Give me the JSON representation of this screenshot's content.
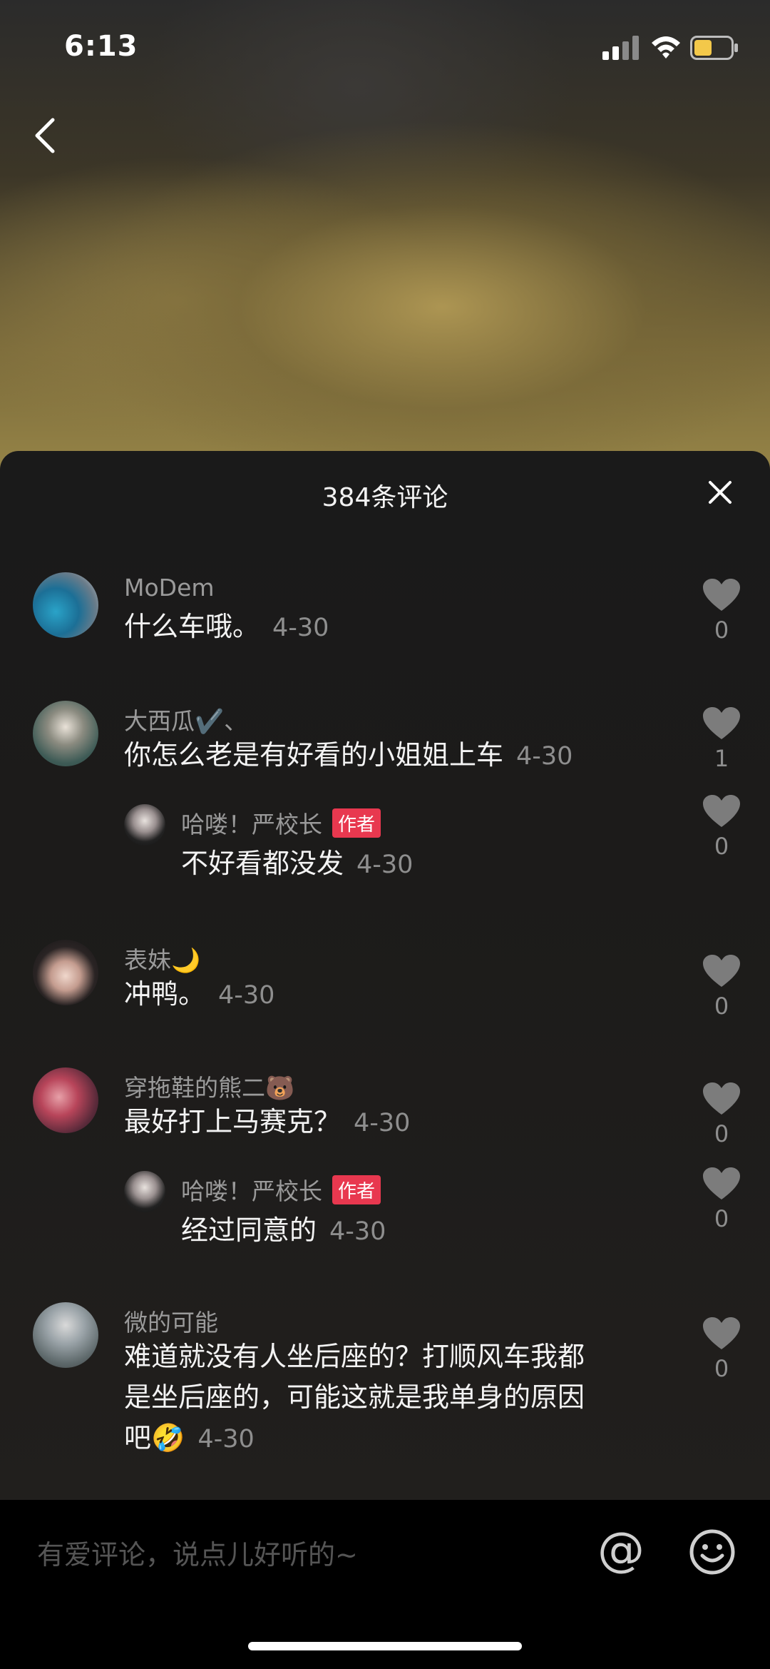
{
  "status_bar": {
    "time": "6:13"
  },
  "sheet": {
    "title": "384条评论"
  },
  "comments": [
    {
      "user": "MoDem",
      "text": "什么车哦。",
      "date": "4-30",
      "likes": "0"
    },
    {
      "user": "大西瓜✔️、",
      "text": "你怎么老是有好看的小姐姐上车",
      "date": "4-30",
      "likes": "1"
    },
    {
      "user": "哈喽！严校长",
      "badge": "作者",
      "text": "不好看都没发",
      "date": "4-30",
      "likes": "0"
    },
    {
      "user": "表妹🌙",
      "text": "冲鸭。",
      "date": "4-30",
      "likes": "0"
    },
    {
      "user": "穿拖鞋的熊二🐻",
      "text": "最好打上马赛克？",
      "date": "4-30",
      "likes": "0"
    },
    {
      "user": "哈喽！严校长",
      "badge": "作者",
      "text": "经过同意的",
      "date": "4-30",
      "likes": "0"
    },
    {
      "user": "微的可能",
      "text_lines": [
        "难道就没有人坐后座的？打顺风车我都",
        "是坐后座的，可能这就是我单身的原因",
        "吧🤣"
      ],
      "date": "4-30",
      "likes": "0"
    }
  ],
  "input": {
    "placeholder": "有爱评论，说点儿好听的~",
    "at_label": "@"
  },
  "colors": {
    "badge": "#e8384f",
    "sheet_bg": "#1c1b1a",
    "secondary_text": "#9a9a9a"
  },
  "icons": [
    "back-arrow-icon",
    "close-icon",
    "heart-icon",
    "emoji-icon",
    "signal-icon",
    "wifi-icon",
    "battery-icon"
  ]
}
